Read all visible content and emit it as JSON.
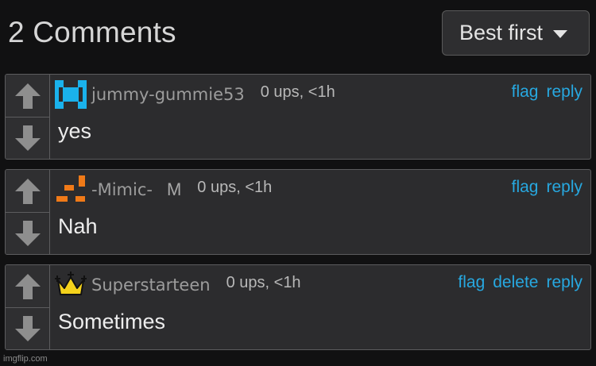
{
  "header": {
    "title": "2 Comments",
    "sort_label": "Best first"
  },
  "comments": [
    {
      "username": "jummy-gummie53",
      "badge": "",
      "stats": "0 ups, <1h",
      "actions": [
        "flag",
        "reply"
      ],
      "text": "yes",
      "avatar_icon": "pixel-x-avatar-icon",
      "avatar_color": "#1ab2ec"
    },
    {
      "username": "-Mimic-",
      "badge": "M",
      "stats": "0 ups, <1h",
      "actions": [
        "flag",
        "reply"
      ],
      "text": "Nah",
      "avatar_icon": "pixel-bars-avatar-icon",
      "avatar_color": "#f07a18"
    },
    {
      "username": "Superstarteen",
      "badge": "",
      "stats": "0 ups, <1h",
      "actions": [
        "flag",
        "delete",
        "reply"
      ],
      "text": "Sometimes",
      "avatar_icon": "crown-avatar-icon",
      "avatar_color": "#f4d21c"
    }
  ],
  "colors": {
    "link": "#27a8e0",
    "background": "#111112",
    "card": "#2c2c2e"
  },
  "footer": {
    "watermark": "imgflip.com"
  }
}
